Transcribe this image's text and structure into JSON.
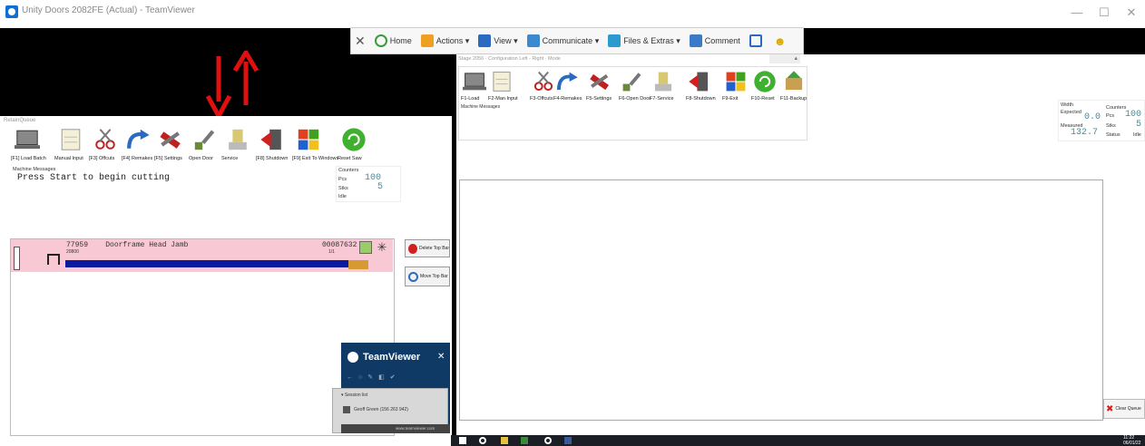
{
  "window": {
    "title": "Unity Doors 2082FE (Actual) - TeamViewer",
    "minimize": "—",
    "maximize": "☐",
    "close": "✕"
  },
  "toolbar": {
    "close": "✕",
    "home": "Home",
    "actions": "Actions ▾",
    "view": "View ▾",
    "communicate": "Communicate ▾",
    "files": "Files & Extras ▾",
    "comment": "Comment",
    "face": "☻"
  },
  "left": {
    "title": "RetainQueue",
    "tools": [
      {
        "label": "[F1] Load Batch",
        "icon": "laptop-icon"
      },
      {
        "label": "Manual Input",
        "icon": "notepad-icon"
      },
      {
        "label": "[F3] Offcuts",
        "icon": "scissors-icon"
      },
      {
        "label": "[F4] Remakes",
        "icon": "redo-arrow-icon"
      },
      {
        "label": "[F5] Settings",
        "icon": "tools-icon"
      },
      {
        "label": "Open Door",
        "icon": "brush-icon"
      },
      {
        "label": "Service",
        "icon": "service-icon"
      },
      {
        "label": "[F8] Shutdown",
        "icon": "shutdown-icon"
      },
      {
        "label": "[F9] Exit To Windows",
        "icon": "windows-icon"
      },
      {
        "label": "Reset Saw",
        "icon": "reset-icon"
      }
    ],
    "messages_label": "Machine Messages",
    "message": "Press Start to begin cutting",
    "counters": {
      "title": "Counters",
      "pcs_label": "Pcs",
      "pcs_value": "100",
      "stks_label": "Stks",
      "stks_value": "5",
      "idle_label": "Idle"
    },
    "row": {
      "id": "77959",
      "name": "Doorframe Head Jamb",
      "sub": "20800",
      "number": "00087632",
      "frac": "1/1"
    },
    "side_buttons": [
      "Delete Top Bar",
      "Move Top Bar"
    ],
    "progress_fraction": 0.96
  },
  "right": {
    "title": "Stage 2056 · Configuration Left - Right · Mode",
    "tools": [
      {
        "label": "F1-Load",
        "icon": "laptop-icon"
      },
      {
        "label": "F2-Man Input",
        "icon": "notepad-icon"
      },
      {
        "label": "F3-Offcuts",
        "icon": "scissors-icon"
      },
      {
        "label": "F4-Remakes",
        "icon": "redo-arrow-icon"
      },
      {
        "label": "F5-Settings",
        "icon": "tools-icon"
      },
      {
        "label": "F6-Open Door",
        "icon": "brush-icon"
      },
      {
        "label": "F7-Service",
        "icon": "service-icon"
      },
      {
        "label": "F8-Shutdown",
        "icon": "shutdown-icon"
      },
      {
        "label": "F9-Exit",
        "icon": "windows-icon"
      },
      {
        "label": "F10-Reset",
        "icon": "reset-icon"
      },
      {
        "label": "F11-Backup",
        "icon": "backup-icon"
      }
    ],
    "messages_label": "Machine Messages",
    "width_label": "Width",
    "expected_label": "Expected",
    "expected_value": "0.0",
    "measured_label": "Measured",
    "measured_value": "132.7",
    "counters": {
      "title": "Counters",
      "pcs_label": "Pcs",
      "pcs_value": "100",
      "stks_label": "Stks",
      "stks_value": "5",
      "status_label": "Status",
      "status_value": "Idle"
    },
    "clear_label": "Clear Queue"
  },
  "teamviewer": {
    "brand": "TeamViewer",
    "close": "✕",
    "session_label": "▾ Session list",
    "user": "Geoff Green (156 263 942)",
    "footer": "www.teamviewer.com"
  },
  "taskbar": {
    "clock_time": "11:22",
    "clock_date": "06/01/22"
  },
  "colors": {
    "accent_red": "#e01010",
    "progress_blue": "#0a1aa0",
    "row_pink": "#f8c8d4",
    "tv_blue": "#0f3a66"
  }
}
